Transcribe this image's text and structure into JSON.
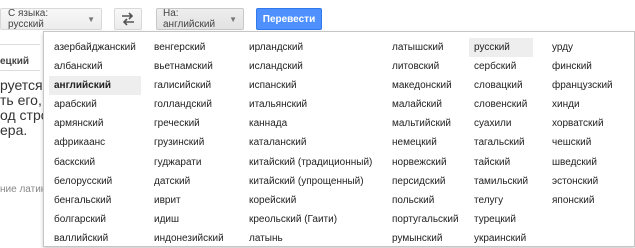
{
  "toolbar": {
    "source_label": "С языка: русский",
    "target_label": "На: английский",
    "translate_label": "Перевести"
  },
  "background": {
    "tab_label": "ецкий",
    "text_lines": "руется в\nть его, т\nод строк\nера.",
    "bottom_text": "ние латин"
  },
  "languages": {
    "selected": "английский",
    "current_source": "русский",
    "columns": [
      [
        "азербайджанский",
        "албанский",
        "английский",
        "арабский",
        "армянский",
        "африкаанс",
        "баскский",
        "белорусский",
        "бенгальский",
        "болгарский",
        "валлийский"
      ],
      [
        "венгерский",
        "вьетнамский",
        "галисийский",
        "голландский",
        "греческий",
        "грузинский",
        "гуджарати",
        "датский",
        "иврит",
        "идиш",
        "индонезийский"
      ],
      [
        "ирландский",
        "исландский",
        "испанский",
        "итальянский",
        "каннада",
        "каталанский",
        "китайский (традиционный)",
        "китайский (упрощенный)",
        "корейский",
        "креольский (Гаити)",
        "латынь"
      ],
      [
        "латышский",
        "литовский",
        "македонский",
        "малайский",
        "мальтийский",
        "немецкий",
        "норвежский",
        "персидский",
        "польский",
        "португальский",
        "румынский"
      ],
      [
        "русский",
        "сербский",
        "словацкий",
        "словенский",
        "суахили",
        "тагальский",
        "тайский",
        "тамильский",
        "телугу",
        "турецкий",
        "украинский"
      ],
      [
        "урду",
        "финский",
        "французский",
        "хинди",
        "хорватский",
        "чешский",
        "шведский",
        "эстонский",
        "японский"
      ]
    ]
  }
}
